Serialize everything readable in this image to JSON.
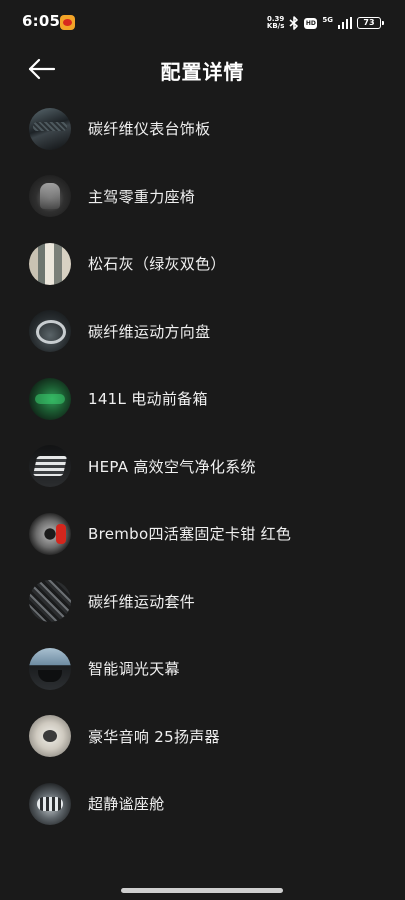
{
  "status_bar": {
    "time": "6:05",
    "net_speed_value": "0.39",
    "net_speed_unit": "KB/s",
    "hd_label": "HD",
    "network_label": "5G",
    "battery": "73",
    "icons": [
      "weibo-icon",
      "bluetooth-icon",
      "signal-icon"
    ]
  },
  "header": {
    "back_icon": "arrow-left-icon",
    "title": "配置详情"
  },
  "items": [
    {
      "label": "碳纤维仪表台饰板",
      "thumb": "dashboard-trim-thumbnail"
    },
    {
      "label": "主驾零重力座椅",
      "thumb": "seat-thumbnail"
    },
    {
      "label": "松石灰（绿灰双色）",
      "thumb": "color-swatch-thumbnail"
    },
    {
      "label": "碳纤维运动方向盘",
      "thumb": "steering-wheel-thumbnail"
    },
    {
      "label": "141L 电动前备箱",
      "thumb": "front-trunk-thumbnail"
    },
    {
      "label": "HEPA 高效空气净化系统",
      "thumb": "air-filter-thumbnail"
    },
    {
      "label": "Brembo四活塞固定卡钳 红色",
      "thumb": "brake-caliper-thumbnail"
    },
    {
      "label": "碳纤维运动套件",
      "thumb": "carbon-fiber-thumbnail"
    },
    {
      "label": "智能调光天幕",
      "thumb": "sunroof-thumbnail"
    },
    {
      "label": "豪华音响 25扬声器",
      "thumb": "speaker-thumbnail"
    },
    {
      "label": "超静谧座舱",
      "thumb": "cabin-thumbnail"
    }
  ],
  "colors": {
    "background": "#1a1a1a",
    "text": "#f0f0f0",
    "brake_accent": "#d3261d"
  }
}
